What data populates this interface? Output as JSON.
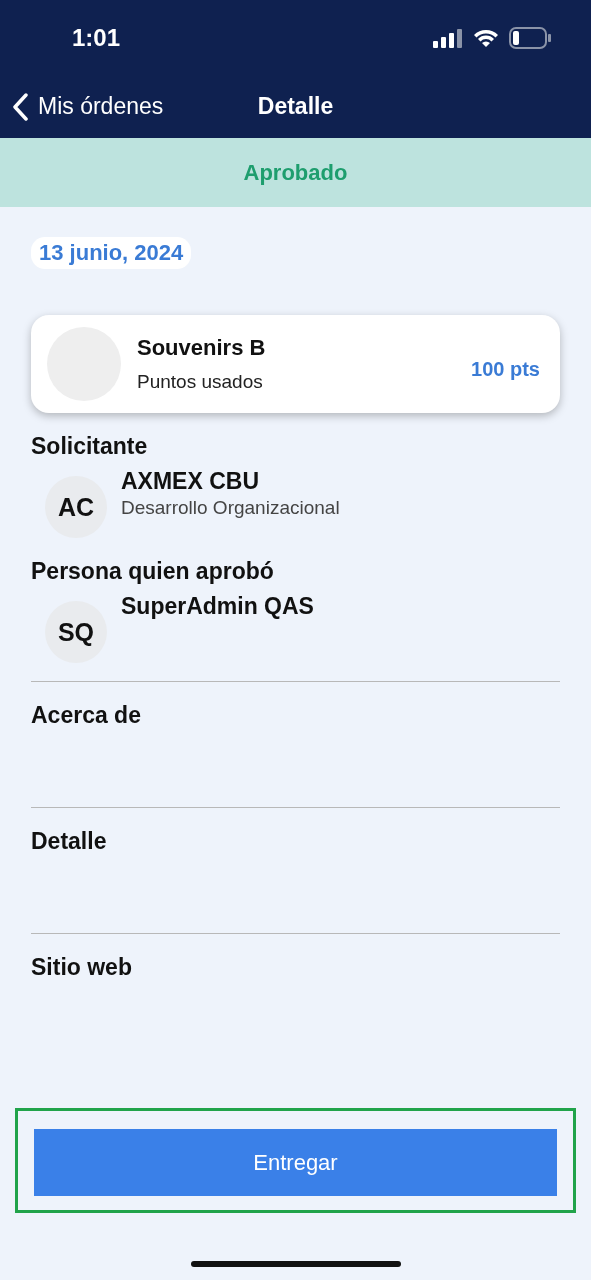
{
  "status_bar": {
    "time": "1:01"
  },
  "nav": {
    "back_label": "Mis órdenes",
    "title": "Detalle"
  },
  "status_banner": {
    "label": "Aprobado"
  },
  "date": "13 junio, 2024",
  "item_card": {
    "name": "Souvenirs B",
    "caption": "Puntos usados",
    "points": "100 pts"
  },
  "people": [
    {
      "heading": "Solicitante",
      "initials": "AC",
      "name": "AXMEX CBU",
      "subtitle": "Desarrollo Organizacional"
    },
    {
      "heading": "Persona quien aprobó",
      "initials": "SQ",
      "name": "SuperAdmin QAS"
    }
  ],
  "sections": [
    {
      "heading": "Acerca de"
    },
    {
      "heading": "Detalle"
    },
    {
      "heading": "Sitio web"
    }
  ],
  "action_button": {
    "label": "Entregar",
    "highlighted": true
  }
}
